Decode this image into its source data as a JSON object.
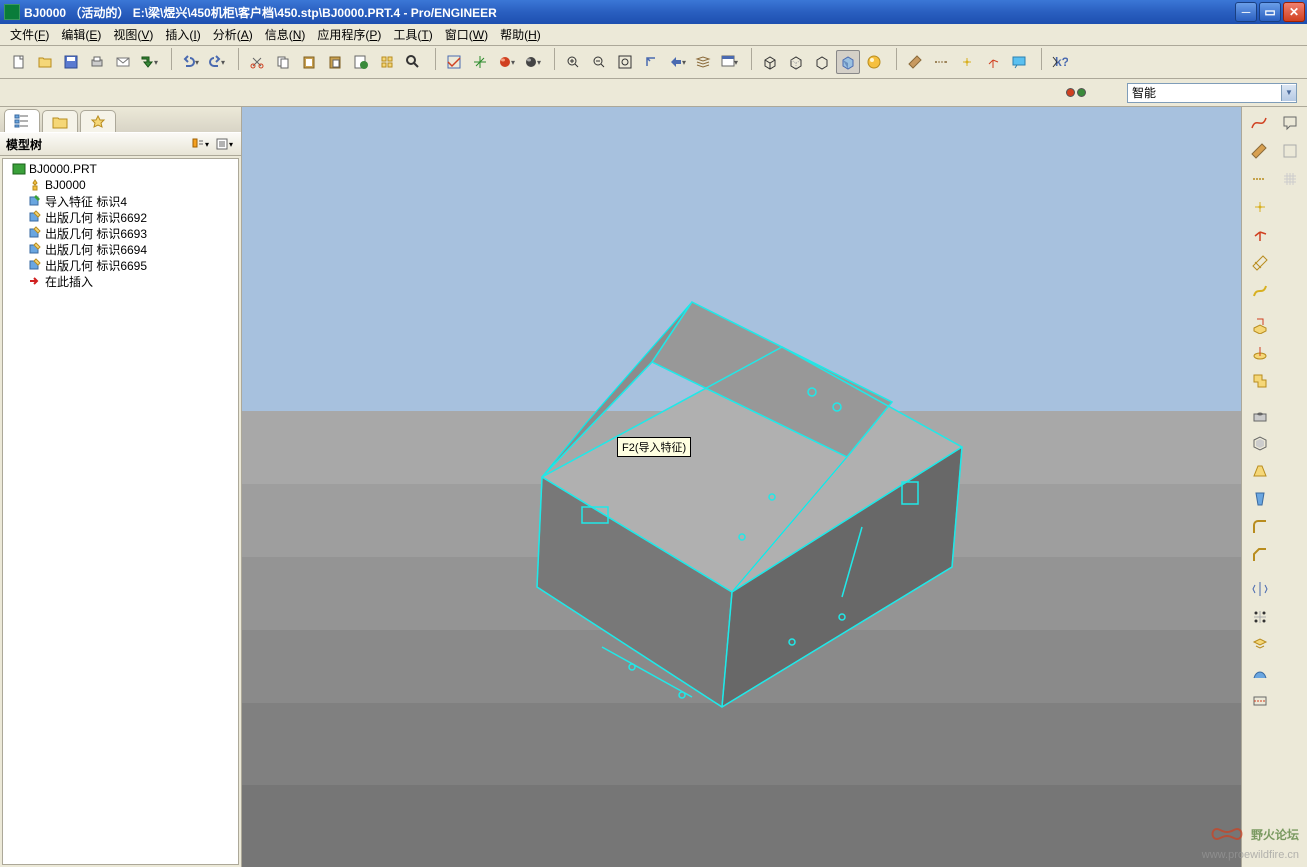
{
  "title": "BJ0000 （活动的） E:\\梁\\煜兴\\450机柜\\客户档\\450.stp\\BJ0000.PRT.4 - Pro/ENGINEER",
  "menu": [
    {
      "label": "文件",
      "acc": "F"
    },
    {
      "label": "编辑",
      "acc": "E"
    },
    {
      "label": "视图",
      "acc": "V"
    },
    {
      "label": "插入",
      "acc": "I"
    },
    {
      "label": "分析",
      "acc": "A"
    },
    {
      "label": "信息",
      "acc": "N"
    },
    {
      "label": "应用程序",
      "acc": "P"
    },
    {
      "label": "工具",
      "acc": "T"
    },
    {
      "label": "窗口",
      "acc": "W"
    },
    {
      "label": "帮助",
      "acc": "H"
    }
  ],
  "filter_value": "智能",
  "sidebar_title": "模型树",
  "tree": [
    {
      "depth": 0,
      "icon": "part",
      "label": "BJ0000.PRT"
    },
    {
      "depth": 1,
      "icon": "light",
      "label": "BJ0000"
    },
    {
      "depth": 1,
      "icon": "feat",
      "label": "导入特征 标识4"
    },
    {
      "depth": 1,
      "icon": "pub",
      "label": "出版几何 标识6692"
    },
    {
      "depth": 1,
      "icon": "pub",
      "label": "出版几何 标识6693"
    },
    {
      "depth": 1,
      "icon": "pub",
      "label": "出版几何 标识6694"
    },
    {
      "depth": 1,
      "icon": "pub",
      "label": "出版几何 标识6695"
    },
    {
      "depth": 1,
      "icon": "insert",
      "label": "在此插入"
    }
  ],
  "tooltip": "F2(导入特征)",
  "watermark": {
    "big": "野火论坛",
    "small": "www.proewildfire.cn"
  }
}
